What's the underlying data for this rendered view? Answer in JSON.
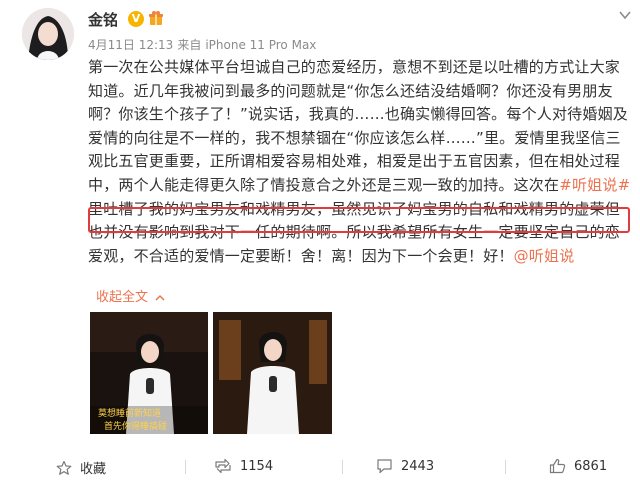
{
  "user": {
    "name": "金铭",
    "verified_badge": "V"
  },
  "meta": {
    "date": "4月11日 12:13",
    "source_prefix": "来自",
    "device": "iPhone 11 Pro Max"
  },
  "post": {
    "text_before_tag": "第一次在公共媒体平台坦诚自己的恋爱经历，意想不到还是以吐槽的方式让大家知道。近几年我被问到最多的问题就是“你怎么还结没结婚啊？你还没有男朋友啊？你该生个孩子了！”说实话，我真的……也确实懒得回答。每个人对待婚姻及爱情的向往是不一样的，我不想禁锢在“你应该怎么样……”里。爱情里我坚信三观比五官更重要，正所谓相爱容易相处难，相爱是出于五官因素，但在相处过程中，两个人能走得更久除了情投意合之外还是三观一致的加持。这次在",
    "tag": "#听姐说#",
    "text_after_tag": "里吐槽了我的妈宝男友和戏精男友，虽然见识了妈宝男的自私和戏精男的虚荣但也并没有影响到我对下一任的期待啊。所以我希望所有女生一定要坚定自己的恋爱观，不合适的爱情一定要断！舍！离！因为下一个会更！好！",
    "mention": "@听姐说",
    "collapse_label": "收起全文"
  },
  "media": {
    "caption_left_1": "莫想睡前新知道",
    "caption_left_2": "首先你得睡搞碰"
  },
  "footer": {
    "favorite_label": "收藏",
    "repost_count": "1154",
    "comment_count": "2443",
    "like_count": "6861"
  },
  "colors": {
    "accent": "#eb7350",
    "highlight_border": "#e23b3b",
    "badge": "#f7b500"
  }
}
